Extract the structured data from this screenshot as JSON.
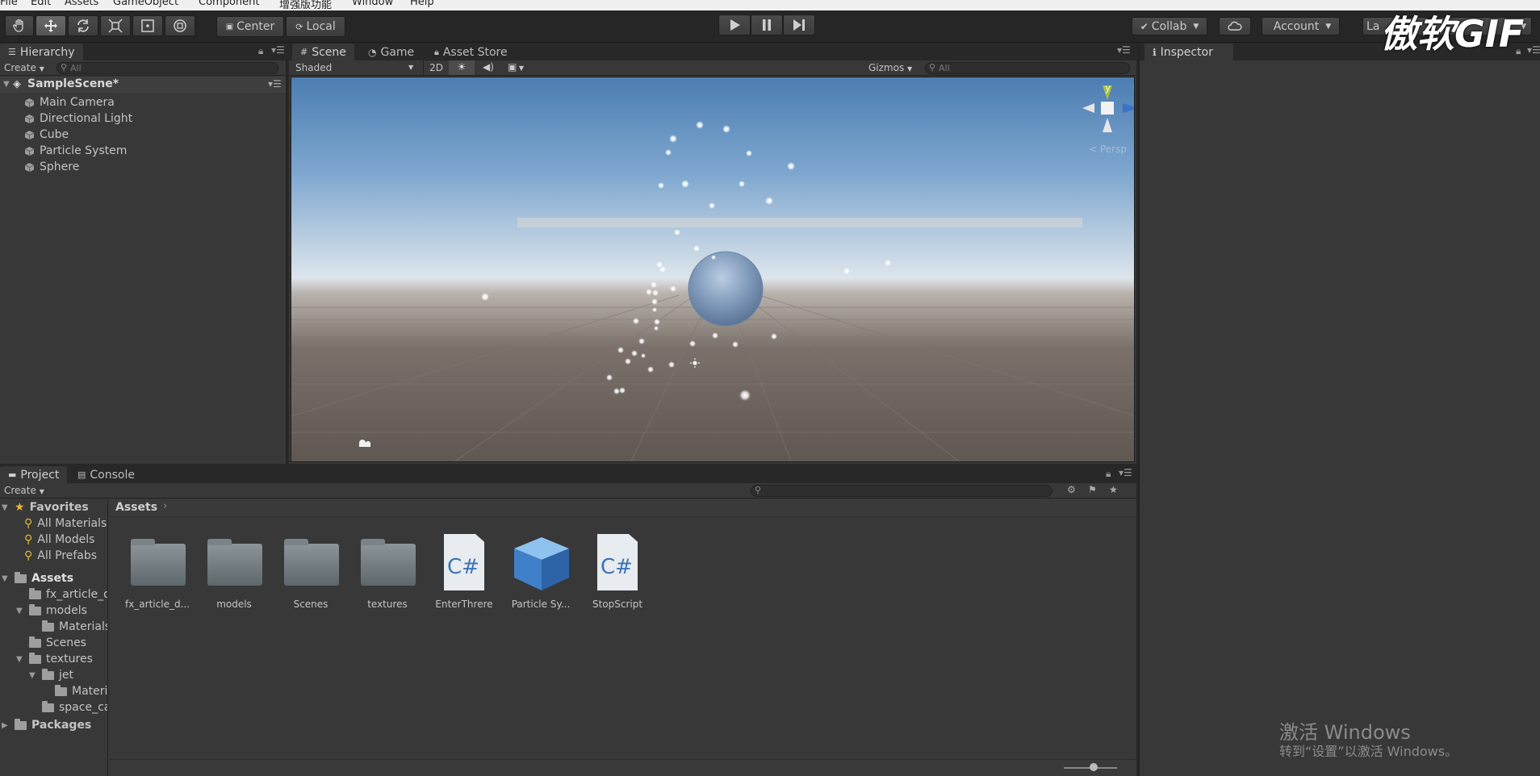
{
  "menu": [
    "File",
    "Edit",
    "Assets",
    "GameObject",
    "Component",
    "增强版功能",
    "Window",
    "Help"
  ],
  "toolbar": {
    "pivot_label": "Center",
    "space_label": "Local",
    "collab_label": "Collab",
    "account_label": "Account",
    "layers_label": "La"
  },
  "hierarchy": {
    "tab_label": "Hierarchy",
    "create_label": "Create",
    "search_placeholder": "All",
    "scene_name": "SampleScene*",
    "items": [
      "Main Camera",
      "Directional Light",
      "Cube",
      "Particle System",
      "Sphere"
    ]
  },
  "scene_view": {
    "tabs": [
      "Scene",
      "Game",
      "Asset Store"
    ],
    "shading_mode": "Shaded",
    "mode_2d": "2D",
    "gizmos_label": "Gizmos",
    "search_placeholder": "All",
    "axis_y": "y",
    "axis_z": "z",
    "persp_label": "< Persp"
  },
  "inspector": {
    "tab_label": "Inspector"
  },
  "project": {
    "tabs": [
      "Project",
      "Console"
    ],
    "create_label": "Create",
    "favorites_label": "Favorites",
    "favorites": [
      "All Materials",
      "All Models",
      "All Prefabs"
    ],
    "assets_label": "Assets",
    "tree": [
      {
        "label": "fx_article_d",
        "indent": 1,
        "arrow": ""
      },
      {
        "label": "models",
        "indent": 1,
        "arrow": "▼"
      },
      {
        "label": "Materials",
        "indent": 2,
        "arrow": ""
      },
      {
        "label": "Scenes",
        "indent": 1,
        "arrow": ""
      },
      {
        "label": "textures",
        "indent": 1,
        "arrow": "▼"
      },
      {
        "label": "jet",
        "indent": 2,
        "arrow": "▼"
      },
      {
        "label": "Materia",
        "indent": 3,
        "arrow": ""
      },
      {
        "label": "space_ca",
        "indent": 2,
        "arrow": ""
      }
    ],
    "packages_label": "Packages",
    "breadcrumb": "Assets",
    "assets": [
      {
        "label": "fx_article_d...",
        "kind": "folder"
      },
      {
        "label": "models",
        "kind": "folder"
      },
      {
        "label": "Scenes",
        "kind": "folder"
      },
      {
        "label": "textures",
        "kind": "folder"
      },
      {
        "label": "EnterThrere",
        "kind": "script"
      },
      {
        "label": "Particle Sy...",
        "kind": "prefab"
      },
      {
        "label": "StopScript",
        "kind": "script"
      }
    ]
  },
  "overlays": {
    "gif_watermark": "傲软GIF",
    "activate_title": "激活 Windows",
    "activate_sub": "转到“设置”以激活 Windows。"
  },
  "colors": {
    "editor_bg": "#282828",
    "panel_bg": "#383838",
    "sky_top": "#4d7fb3",
    "ground": "#6b625c",
    "csharp": "#3f73b8"
  }
}
